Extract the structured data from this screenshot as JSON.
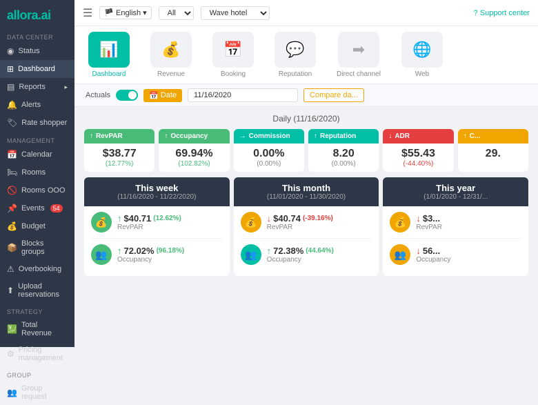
{
  "sidebar": {
    "logo": "allora.ai",
    "sections": [
      {
        "label": "DATA CENTER",
        "items": [
          {
            "id": "status",
            "label": "Status",
            "icon": "◉",
            "active": false
          },
          {
            "id": "dashboard",
            "label": "Dashboard",
            "icon": "⊞",
            "active": true
          },
          {
            "id": "reports",
            "label": "Reports",
            "icon": "📋",
            "active": false,
            "arrow": true
          },
          {
            "id": "alerts",
            "label": "Alerts",
            "icon": "🔔",
            "active": false
          },
          {
            "id": "rate-shopper",
            "label": "Rate shopper",
            "icon": "🏷",
            "active": false
          }
        ]
      },
      {
        "label": "MANAGEMENT",
        "items": [
          {
            "id": "calendar",
            "label": "Calendar",
            "icon": "📅",
            "active": false
          },
          {
            "id": "rooms",
            "label": "Rooms",
            "icon": "🛏",
            "active": false
          },
          {
            "id": "rooms-ooo",
            "label": "Rooms OOO",
            "icon": "🚫",
            "active": false
          },
          {
            "id": "events",
            "label": "Events",
            "icon": "📌",
            "active": false,
            "badge": "54"
          },
          {
            "id": "budget",
            "label": "Budget",
            "icon": "💰",
            "active": false
          },
          {
            "id": "blocks-groups",
            "label": "Blocks groups",
            "icon": "📦",
            "active": false
          },
          {
            "id": "overbooking",
            "label": "Overbooking",
            "icon": "⚠",
            "active": false
          },
          {
            "id": "upload-reservations",
            "label": "Upload reservations",
            "icon": "⬆",
            "active": false
          }
        ]
      },
      {
        "label": "STRATEGY",
        "items": [
          {
            "id": "total-revenue",
            "label": "Total Revenue",
            "icon": "💹",
            "active": false
          },
          {
            "id": "pricing-management",
            "label": "Pricing management",
            "icon": "⚙",
            "active": false
          }
        ]
      },
      {
        "label": "GROUP",
        "items": [
          {
            "id": "group-request",
            "label": "Group request",
            "icon": "👥",
            "active": false
          }
        ]
      }
    ]
  },
  "topbar": {
    "lang": "English",
    "all_select": "All",
    "hotel": "Wave hotel",
    "support": "? Support center"
  },
  "nav_icons": [
    {
      "id": "dashboard",
      "label": "Dashboard",
      "icon": "📊",
      "active": true
    },
    {
      "id": "revenue",
      "label": "Revenue",
      "icon": "💰",
      "active": false
    },
    {
      "id": "booking",
      "label": "Booking",
      "icon": "📅",
      "active": false
    },
    {
      "id": "reputation",
      "label": "Reputation",
      "icon": "💬",
      "active": false
    },
    {
      "id": "direct-channel",
      "label": "Direct channel",
      "icon": "➡",
      "active": false
    },
    {
      "id": "web",
      "label": "Web",
      "icon": "🌐",
      "active": false
    }
  ],
  "filter_bar": {
    "actuals_label": "Actuals",
    "date_btn": "Date",
    "date_value": "11/16/2020",
    "compare_btn": "Compare da..."
  },
  "daily": {
    "title": "Daily (11/16/2020)"
  },
  "metric_cards": [
    {
      "id": "revpar",
      "header": "RevPAR",
      "header_color": "green",
      "arrow": "↑",
      "value": "$38.77",
      "change": "(12.77%)",
      "change_color": "green"
    },
    {
      "id": "occupancy",
      "header": "Occupancy",
      "header_color": "green",
      "arrow": "↑",
      "value": "69.94%",
      "change": "(102.82%)",
      "change_color": "green"
    },
    {
      "id": "commission",
      "header": "Commission",
      "header_color": "teal",
      "arrow": "→",
      "value": "0.00%",
      "change": "(0.00%)",
      "change_color": "neutral"
    },
    {
      "id": "reputation",
      "header": "Reputation",
      "header_color": "teal",
      "arrow": "↑",
      "value": "8.20",
      "change": "(0.00%)",
      "change_color": "neutral"
    },
    {
      "id": "adr",
      "header": "ADR",
      "header_color": "red",
      "arrow": "↓",
      "value": "$55.43",
      "change": "(-44.40%)",
      "change_color": "red"
    },
    {
      "id": "col6",
      "header": "C...",
      "header_color": "orange",
      "arrow": "↑",
      "value": "29.",
      "change": "",
      "change_color": "green"
    }
  ],
  "period_cards": [
    {
      "id": "this-week",
      "title": "This week",
      "dates": "(11/16/2020 - 11/22/2020)",
      "rows": [
        {
          "icon": "💰",
          "icon_color": "green",
          "arrow": "↑",
          "arrow_color": "up",
          "value": "$40.71",
          "change": "(12.62%)",
          "change_color": "green",
          "label": "RevPAR"
        },
        {
          "icon": "👥",
          "icon_color": "green",
          "arrow": "↑",
          "arrow_color": "up",
          "value": "72.02%",
          "change": "(96.18%)",
          "change_color": "green",
          "label": "Occupancy"
        }
      ]
    },
    {
      "id": "this-month",
      "title": "This month",
      "dates": "(11/01/2020 - 11/30/2020)",
      "rows": [
        {
          "icon": "💰",
          "icon_color": "orange",
          "arrow": "↓",
          "arrow_color": "down",
          "value": "$40.74",
          "change": "(-39.16%)",
          "change_color": "red",
          "label": "RevPAR"
        },
        {
          "icon": "👥",
          "icon_color": "teal",
          "arrow": "↑",
          "arrow_color": "up",
          "value": "72.38%",
          "change": "(44.64%)",
          "change_color": "green",
          "label": "Occupancy"
        }
      ]
    },
    {
      "id": "this-year",
      "title": "This year",
      "dates": "(1/01/2020 - 12/31/...",
      "rows": [
        {
          "icon": "💰",
          "icon_color": "orange",
          "arrow": "↓",
          "arrow_color": "down",
          "value": "$3...",
          "change": "",
          "change_color": "red",
          "label": "RevPAR"
        },
        {
          "icon": "👥",
          "icon_color": "orange",
          "arrow": "↓",
          "arrow_color": "down",
          "value": "56...",
          "change": "",
          "change_color": "red",
          "label": "Occupancy"
        }
      ]
    }
  ]
}
